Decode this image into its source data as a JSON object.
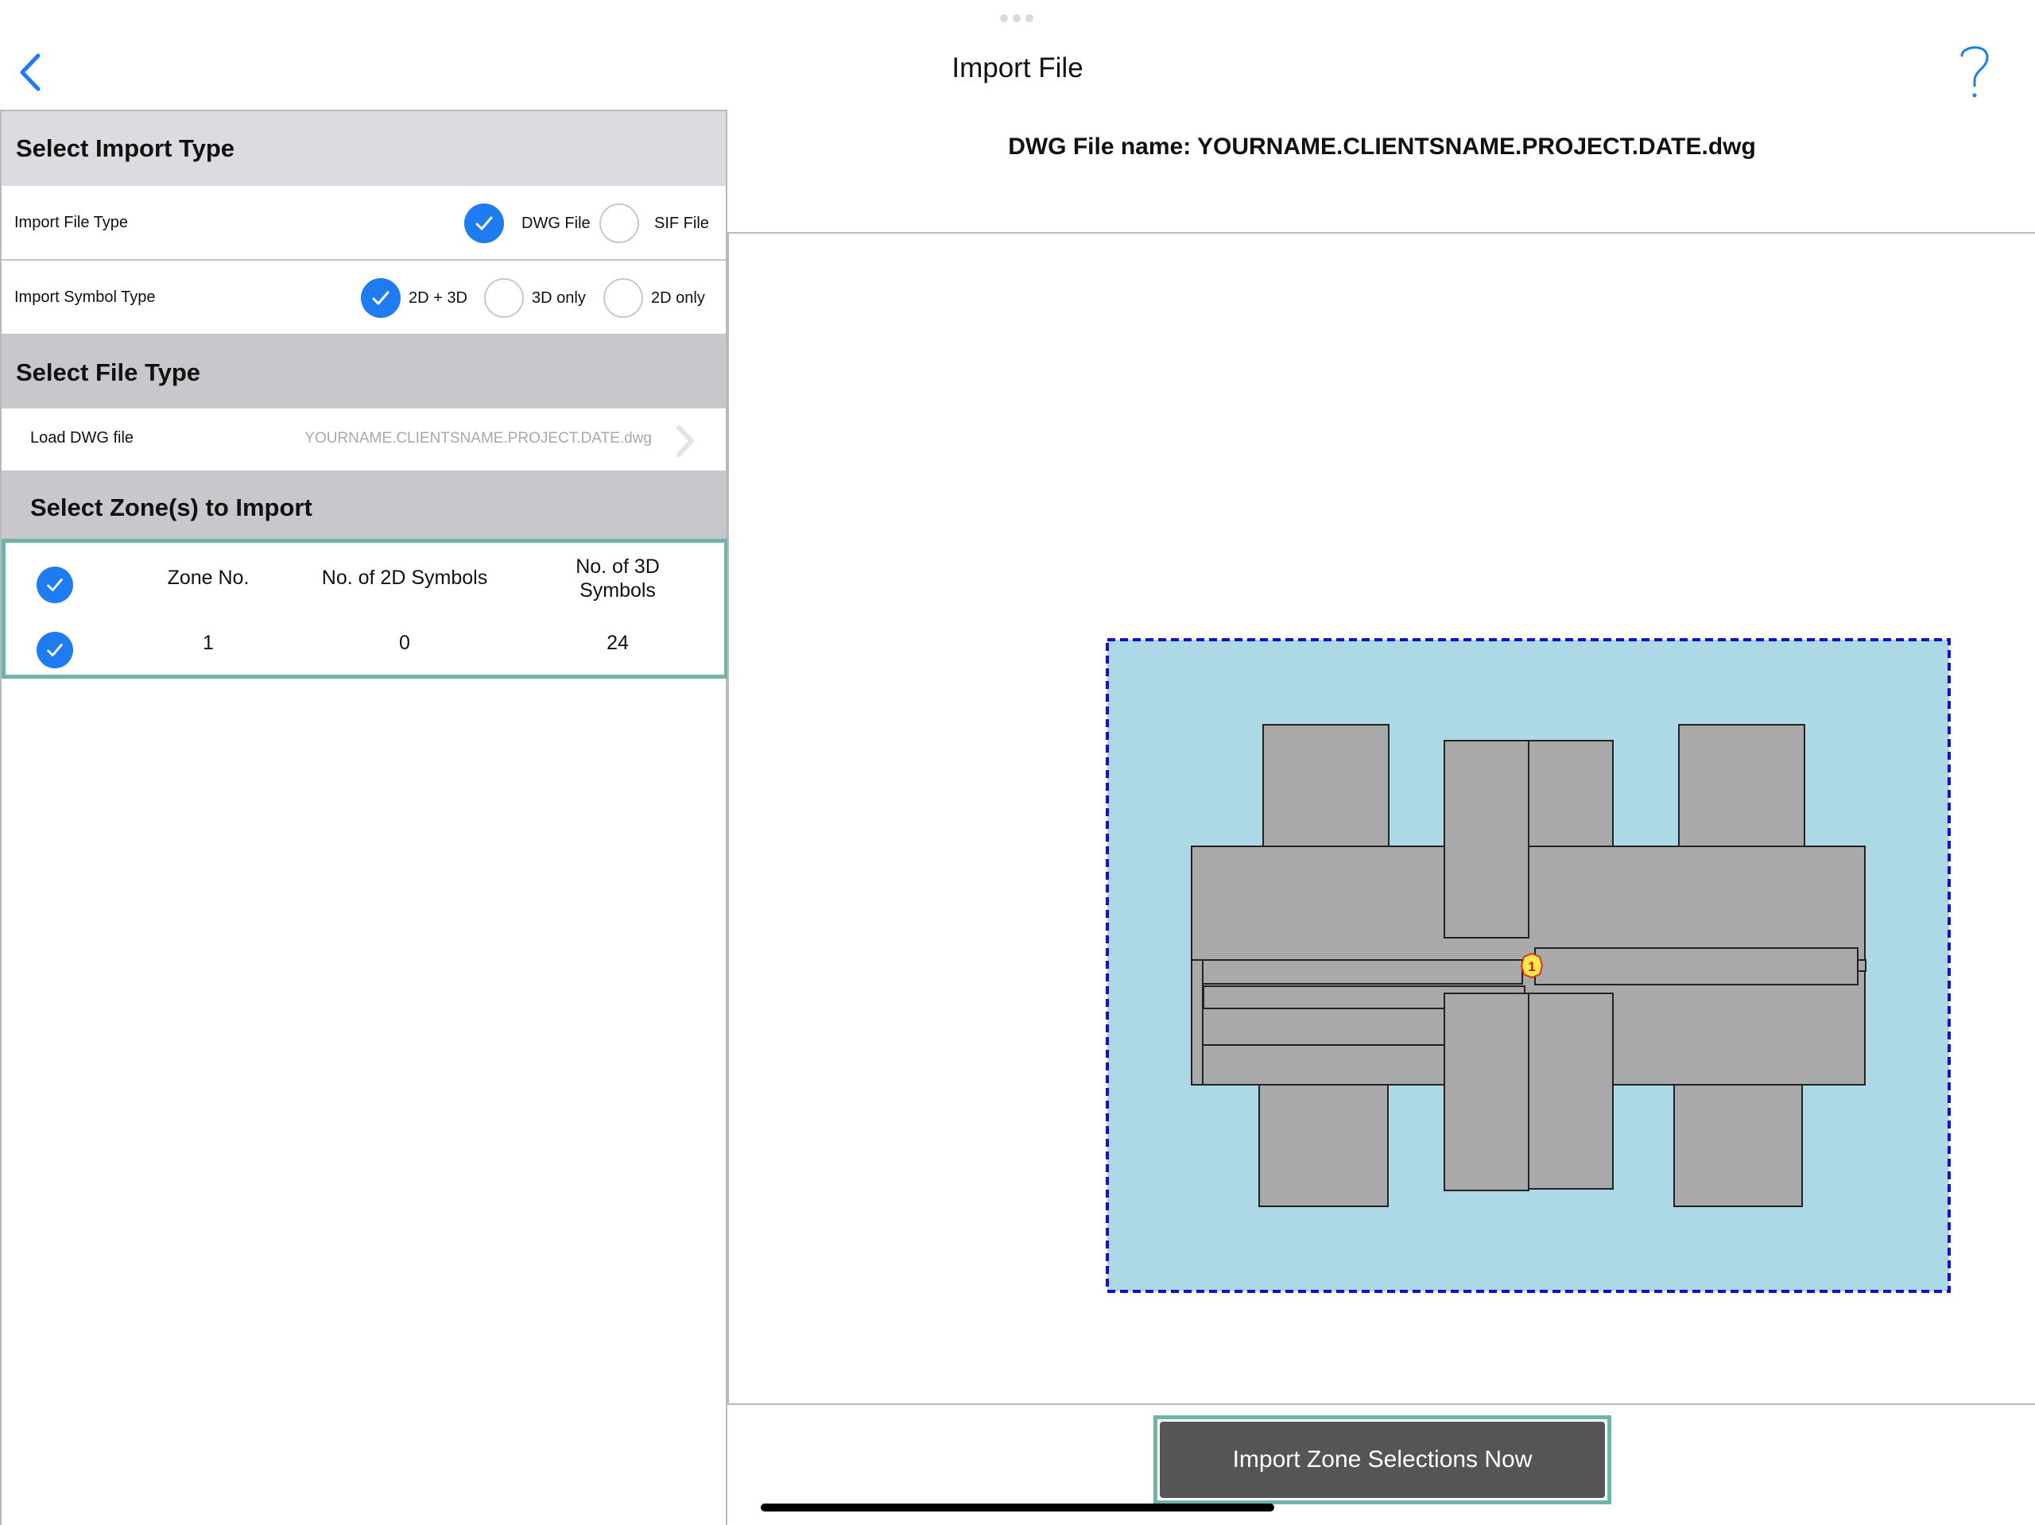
{
  "nav": {
    "title": "Import File",
    "back_icon": "chevron-left-icon",
    "help_icon": "question-mark-icon",
    "accent_color": "#1e7cf0"
  },
  "import_type": {
    "header": "Select Import Type",
    "file_type": {
      "label": "Import File Type",
      "options": [
        {
          "label": "DWG File",
          "selected": true
        },
        {
          "label": "SIF File",
          "selected": false
        }
      ]
    },
    "symbol_type": {
      "label": "Import Symbol Type",
      "options": [
        {
          "label": "2D + 3D",
          "selected": true
        },
        {
          "label": "3D only",
          "selected": false
        },
        {
          "label": "2D only",
          "selected": false
        }
      ]
    }
  },
  "file_type": {
    "header": "Select File Type",
    "load_label": "Load DWG file",
    "load_value": "YOURNAME.CLIENTSNAME.PROJECT.DATE.dwg"
  },
  "zones": {
    "header": "Select Zone(s) to Import",
    "columns": [
      "Zone No.",
      "No. of 2D Symbols",
      "No. of 3D Symbols"
    ],
    "all_selected": true,
    "rows": [
      {
        "selected": true,
        "zone": "1",
        "symbols_2d": "0",
        "symbols_3d": "24"
      }
    ]
  },
  "preview": {
    "file_name": "DWG File name: YOURNAME.CLIENTSNAME.PROJECT.DATE.dwg",
    "zone_marker": "1",
    "zone_fill": "#add8e6",
    "zone_border": "#1010d0",
    "symbol_fill": "#a9a9a9"
  },
  "import_button": "Import Zone Selections Now"
}
